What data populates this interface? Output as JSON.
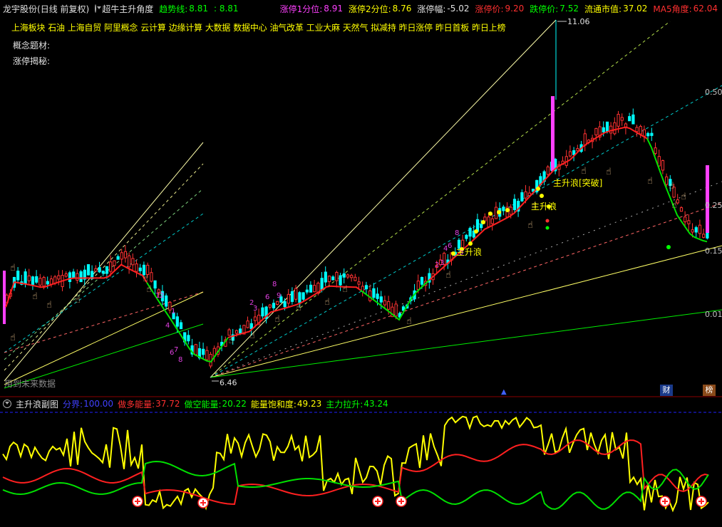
{
  "header": {
    "stock": "龙宇股份",
    "mode": "(日线 前复权)",
    "indicator": "超牛主升角度",
    "trend_label": "趋势线:",
    "trend_value": "8.81",
    "trend_value2": ": 8.81",
    "zt1_label": "涨停1分位:",
    "zt1_value": "8.91",
    "zt2_label": "涨停2分位:",
    "zt2_value": "8.76",
    "ztfu_label": "涨停幅:",
    "ztfu_value": "-5.02",
    "ztj_label": "涨停价:",
    "ztj_value": "9.20",
    "dtj_label": "跌停价:",
    "dtj_value": "7.52",
    "ltsz_label": "流通市值:",
    "ltsz_value": "37.02",
    "ma5_label": "MA5角度:",
    "ma5_value": "62.04"
  },
  "concept_tags": [
    "上海板块",
    "石油",
    "上海自贸",
    "阿里概念",
    "云计算",
    "边缘计算",
    "大数据",
    "数据中心",
    "油气改革",
    "工业大麻",
    "天然气",
    "拟减持",
    "昨日涨停",
    "昨日首板",
    "昨日上榜"
  ],
  "left_labels": {
    "concept": "概念题材:",
    "secret": "涨停揭秘:"
  },
  "price_marks": {
    "high": "11.06",
    "low": "6.46"
  },
  "right_axis": [
    "0.50",
    "0.25",
    "0.15",
    "0.01"
  ],
  "annotations": {
    "zhushenglang": "主升浪",
    "zhushenglang_break": "主升浪[突破]",
    "future": "用到未来数据"
  },
  "corner_labels": {
    "cai": "财",
    "bang": "榜"
  },
  "sub": {
    "title": "主升浪副图",
    "fenjie_label": "分界:",
    "fenjie_value": "100.00",
    "zuoduo_label": "做多能量:",
    "zuoduo_value": "37.72",
    "zuokong_label": "做空能量:",
    "zuokong_value": "20.22",
    "baohe_label": "能量饱和度:",
    "baohe_value": "49.23",
    "lashen_label": "主力拉升:",
    "lashen_value": "43.24"
  },
  "colors": {
    "up": "#ff3232",
    "down": "#00ffff",
    "ma": "#ff2020",
    "ma_green": "#00e000",
    "magenta": "#ff40ff",
    "yellow": "#ffff00"
  }
}
